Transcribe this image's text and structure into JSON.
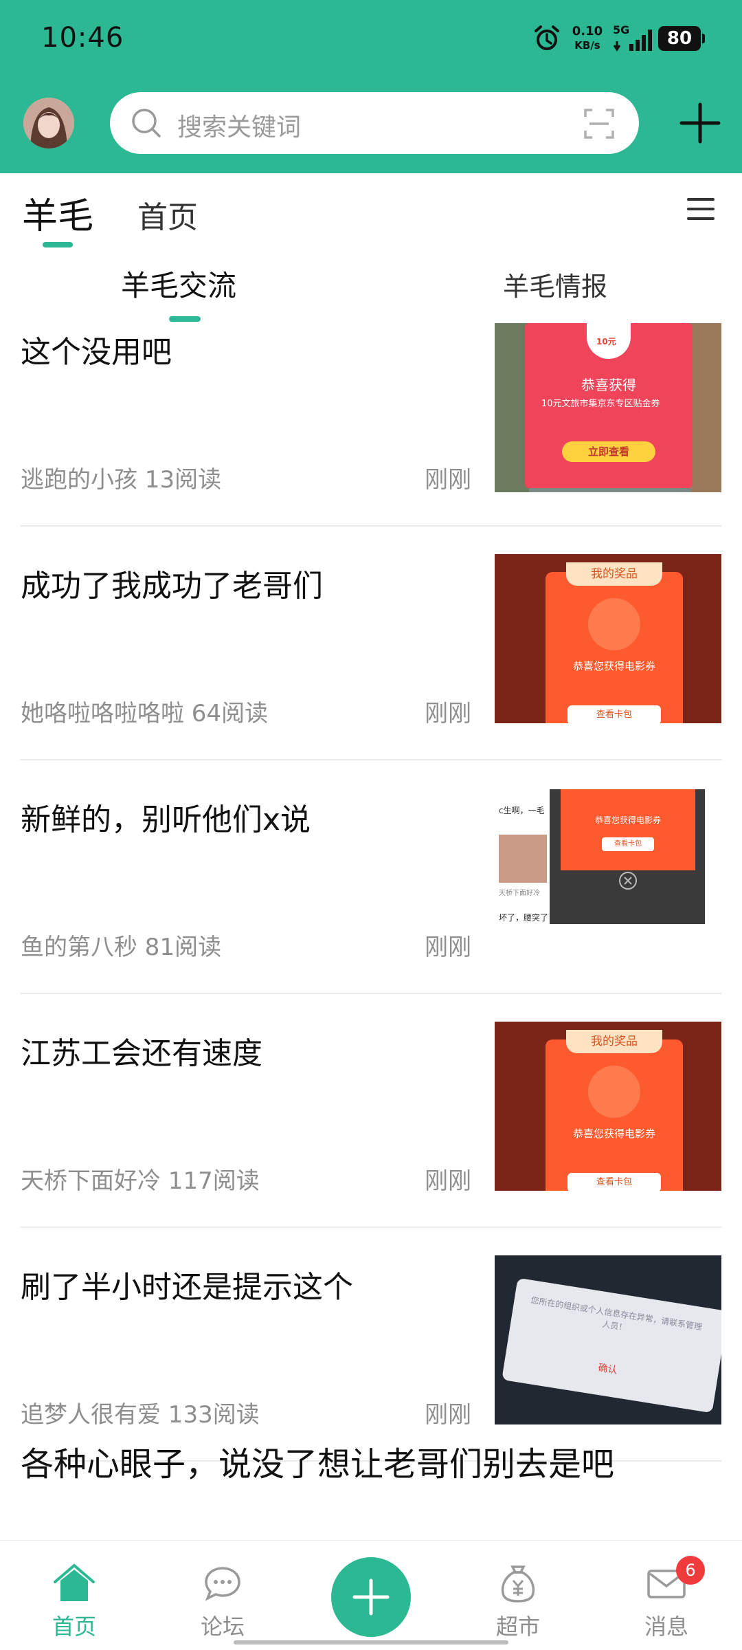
{
  "status_bar": {
    "time": "10:46",
    "net_speed_value": "0.10",
    "net_speed_unit": "KB/s",
    "network": "5G",
    "battery": "80"
  },
  "header": {
    "search_placeholder": "搜索关键词",
    "accent_color": "#2db894"
  },
  "tabs": [
    {
      "label": "羊毛",
      "active": true
    },
    {
      "label": "首页",
      "active": false
    }
  ],
  "subtabs": [
    {
      "label": "羊毛交流",
      "active": true
    },
    {
      "label": "羊毛情报",
      "active": false
    }
  ],
  "posts": [
    {
      "title": "这个没用吧",
      "meta": "逃跑的小孩 13阅读",
      "time": "刚刚",
      "thumb": {
        "heading": "恭喜获得",
        "body": "10元文旅市集京东专区贴金券",
        "button": "立即查看",
        "coupon": "10元"
      }
    },
    {
      "title": "成功了我成功了老哥们",
      "meta": "她咯啦咯啦咯啦 64阅读",
      "time": "刚刚",
      "thumb": {
        "heading": "我的奖品",
        "body": "恭喜您获得电影券",
        "button": "查看卡包"
      }
    },
    {
      "title": "新鲜的，别听他们x说",
      "meta": "鱼的第八秒 81阅读",
      "time": "刚刚",
      "thumb": {
        "body": "恭喜您获得电影券",
        "button": "查看卡包",
        "bg_text_1": "c生啊，一毛",
        "bg_text_2": "天桥下面好冷",
        "bg_text_3": "坏了，腰突了"
      }
    },
    {
      "title": "江苏工会还有速度",
      "meta": "天桥下面好冷 117阅读",
      "time": "刚刚",
      "thumb": {
        "heading": "我的奖品",
        "body": "恭喜您获得电影券",
        "button": "查看卡包"
      }
    },
    {
      "title": "刷了半小时还是提示这个",
      "meta": "追梦人很有爱 133阅读",
      "time": "刚刚",
      "thumb": {
        "body": "您所在的组织或个人信息存在异常，请联系管理人员！",
        "button": "确认"
      }
    }
  ],
  "partial_post_title": "各种心眼子，说没了想让老哥们别去是吧",
  "bottom_nav": {
    "home": "首页",
    "forum": "论坛",
    "market": "超市",
    "messages": "消息",
    "messages_badge": "6"
  }
}
